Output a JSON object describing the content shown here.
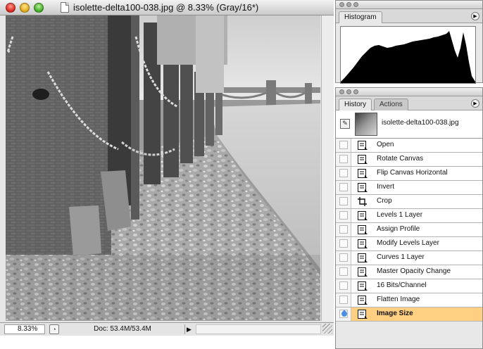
{
  "document": {
    "title": "isolette-delta100-038.jpg @ 8.33% (Gray/16*)",
    "zoom": "8.33%",
    "doc_size": "Doc: 53.4M/53.4M",
    "status_menu_icon": "triangle-right-icon"
  },
  "histogram_palette": {
    "tab": "Histogram",
    "menu_icon": "circle-arrow-icon"
  },
  "history_palette": {
    "tabs": [
      {
        "label": "History"
      },
      {
        "label": "Actions"
      }
    ],
    "snapshot": {
      "name": "isolette-delta100-038.jpg"
    },
    "items": [
      {
        "label": "Open",
        "icon": "document-icon"
      },
      {
        "label": "Rotate Canvas",
        "icon": "document-icon"
      },
      {
        "label": "Flip Canvas Horizontal",
        "icon": "document-icon"
      },
      {
        "label": "Invert",
        "icon": "document-icon"
      },
      {
        "label": "Crop",
        "icon": "crop-icon"
      },
      {
        "label": "Levels 1 Layer",
        "icon": "document-icon"
      },
      {
        "label": "Assign Profile",
        "icon": "document-icon"
      },
      {
        "label": "Modify Levels Layer",
        "icon": "document-icon"
      },
      {
        "label": "Curves 1 Layer",
        "icon": "document-icon"
      },
      {
        "label": "Master Opacity Change",
        "icon": "document-icon"
      },
      {
        "label": "16 Bits/Channel",
        "icon": "document-icon"
      },
      {
        "label": "Flatten Image",
        "icon": "document-icon"
      },
      {
        "label": "Image Size",
        "icon": "document-icon"
      }
    ],
    "current_index": 12,
    "highlight_color": "#ffcf82"
  }
}
